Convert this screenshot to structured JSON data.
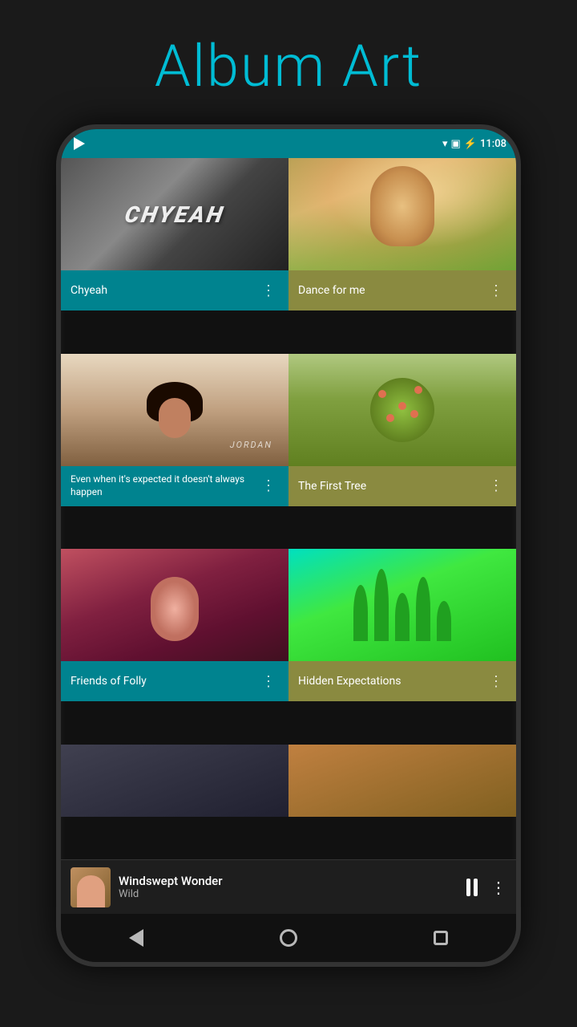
{
  "page": {
    "title": "Album Art",
    "title_color": "#00bcd4"
  },
  "statusBar": {
    "time": "11:08"
  },
  "albums": [
    {
      "id": "chyeah",
      "name": "Chyeah",
      "art_type": "chyeah",
      "label_color": "teal"
    },
    {
      "id": "dance",
      "name": "Dance for me",
      "art_type": "dance",
      "label_color": "olive"
    },
    {
      "id": "jordan",
      "name": "Even when it's expected it doesn't always happen",
      "art_type": "jordan",
      "label_color": "teal",
      "multiline": true
    },
    {
      "id": "tree",
      "name": "The First Tree",
      "art_type": "tree",
      "label_color": "olive"
    },
    {
      "id": "folly",
      "name": "Friends of Folly",
      "art_type": "folly",
      "label_color": "teal"
    },
    {
      "id": "hidden",
      "name": "Hidden Expectations",
      "art_type": "hidden",
      "label_color": "olive"
    }
  ],
  "nowPlaying": {
    "title": "Windswept Wonder",
    "artist": "Wild"
  },
  "dots": "⋮",
  "navButtons": {
    "back": "◁",
    "home": "○",
    "recents": "□"
  }
}
